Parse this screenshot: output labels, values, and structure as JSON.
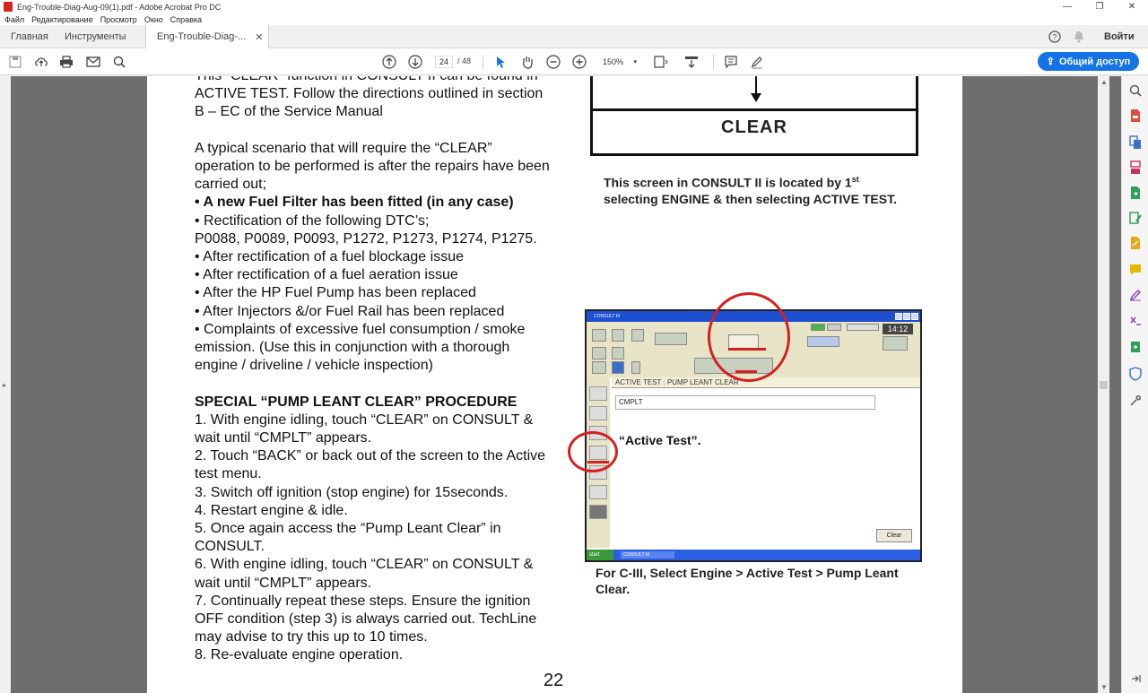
{
  "window": {
    "title": "Eng-Trouble-Diag-Aug-09(1).pdf - Adobe Acrobat Pro DC",
    "minimize": "—",
    "maximize": "❐",
    "close": "✕"
  },
  "menu": [
    "Файл",
    "Редактирование",
    "Просмотр",
    "Окно",
    "Справка"
  ],
  "tabs": {
    "home": "Главная",
    "tools": "Инструменты",
    "doc": "Eng-Trouble-Diag-...",
    "close": "✕",
    "signin": "Войти"
  },
  "toolbar": {
    "page_current": "24",
    "page_total": "/   48",
    "zoom": "150%",
    "share_label": "Общий доступ"
  },
  "document": {
    "left_lines": [
      "This “CLEAR” function in CONSULT II can be found in",
      "ACTIVE TEST. Follow the directions outlined in section",
      "B – EC of the Service Manual",
      "",
      "A typical scenario that will require the “CLEAR”",
      "operation to be performed is after the repairs have been",
      "carried out;",
      "• A new Fuel Filter has been fitted (in any case)",
      "• Rectification of the following DTC’s;",
      "P0088, P0089, P0093, P1272, P1273, P1274, P1275.",
      "• After rectification of a fuel blockage issue",
      "• After rectification of a fuel aeration issue",
      "• After the HP Fuel Pump has been replaced",
      "• After Injectors &/or Fuel Rail has been replaced",
      "• Complaints of excessive fuel consumption / smoke",
      "emission. (Use this in conjunction with a thorough",
      "engine / driveline / vehicle inspection)",
      "",
      "SPECIAL “PUMP LEANT CLEAR” PROCEDURE",
      "1. With engine idling, touch “CLEAR” on CONSULT &",
      "wait until “CMPLT” appears.",
      "2. Touch “BACK” or back out of the screen to the Active",
      "test menu.",
      "3. Switch off ignition (stop engine) for 15seconds.",
      "4. Restart engine & idle.",
      "5. Once again access the “Pump Leant Clear” in",
      "CONSULT.",
      "6. With engine idling, touch “CLEAR” on CONSULT &",
      "wait until “CMPLT” appears.",
      "7. Continually repeat these steps. Ensure the ignition",
      "OFF condition (step 3) is always carried out.  TechLine",
      "may advise to try this up to 10 times.",
      "8. Re-evaluate engine operation."
    ],
    "clear_box_label": "CLEAR",
    "caption1_a": "This screen in CONSULT II is located by 1",
    "caption1_sup": "st",
    "caption1_b": "selecting ENGINE & then selecting ACTIVE TEST.",
    "screenshot": {
      "window_title": "CONSULT III",
      "time": "14:12",
      "banner": "ACTIVE TEST : PUMP LEANT CLEAR",
      "field_value": "CMPLT",
      "active_test_label": "“Active Test”.",
      "clear_button": "Clear",
      "start": "start",
      "task": "CONSULT III"
    },
    "caption2": "For C-III, Select Engine > Active Test > Pump Leant Clear.",
    "page_number": "22"
  },
  "colors": {
    "accent": "#1473e6",
    "highlight_red": "#d42020"
  }
}
